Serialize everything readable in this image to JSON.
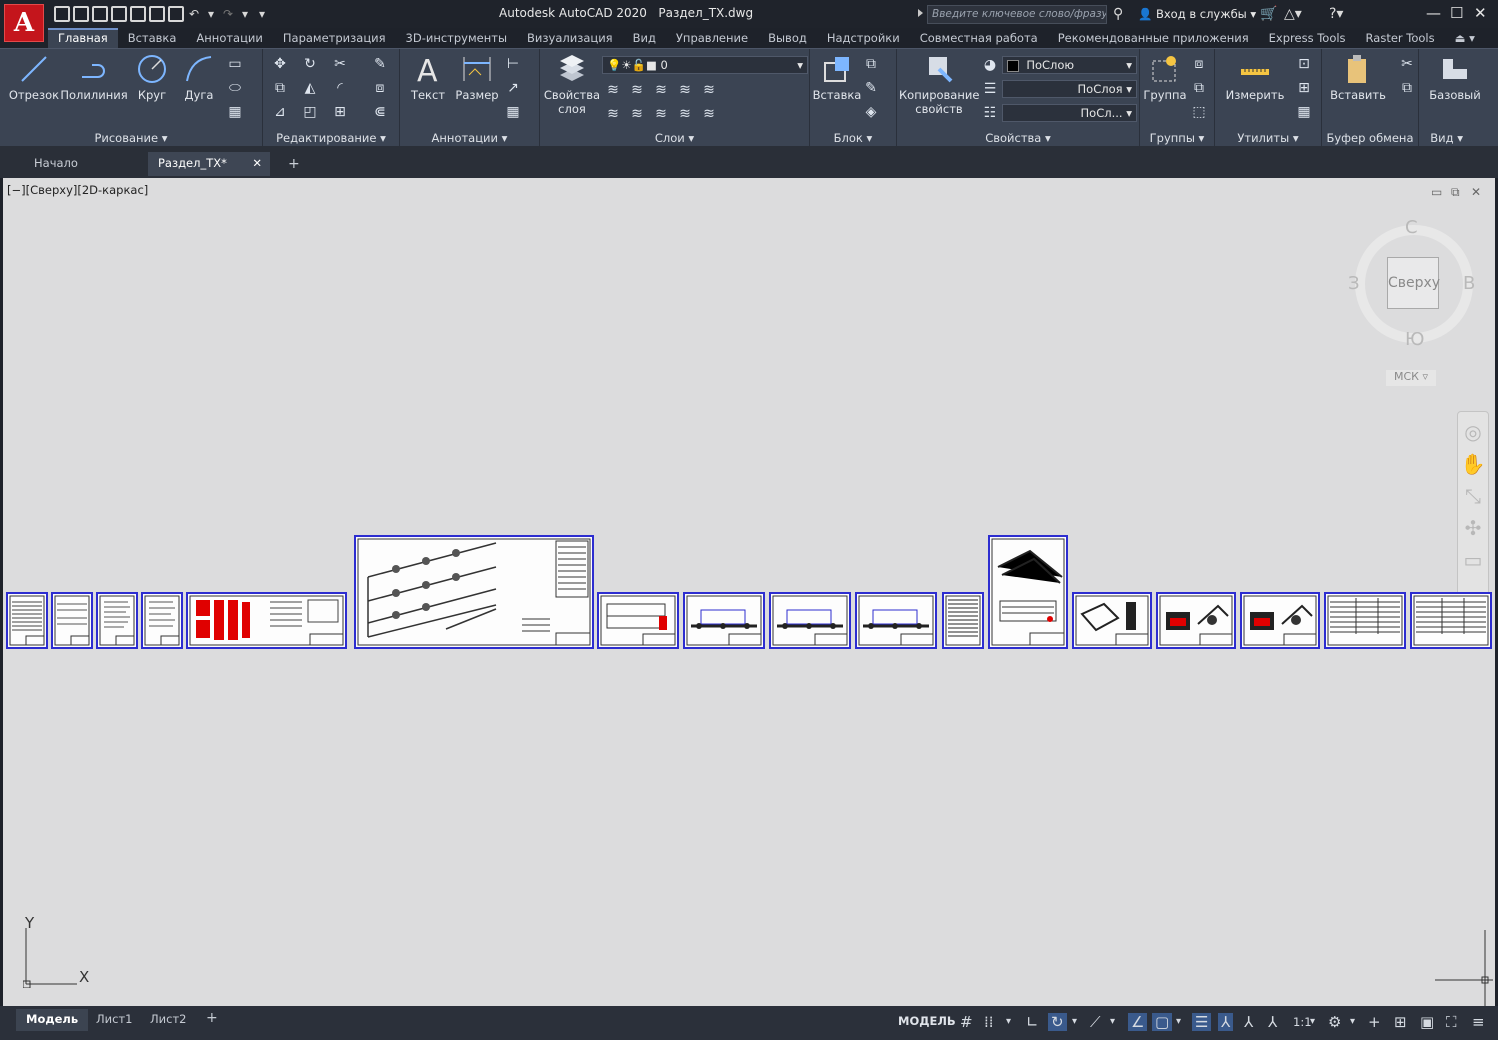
{
  "app": {
    "title": "Autodesk AutoCAD 2020",
    "filename": "Раздел_ТХ.dwg",
    "logo_letter": "A",
    "search_placeholder": "Введите ключевое слово/фразу",
    "signin": "Вход в службы"
  },
  "ribbon_tabs": [
    "Главная",
    "Вставка",
    "Аннотации",
    "Параметризация",
    "3D-инструменты",
    "Визуализация",
    "Вид",
    "Управление",
    "Вывод",
    "Надстройки",
    "Совместная работа",
    "Рекомендованные приложения",
    "Express Tools",
    "Raster Tools"
  ],
  "draw": {
    "line": "Отрезок",
    "polyline": "Полилиния",
    "circle": "Круг",
    "arc": "Дуга",
    "panel": "Рисование"
  },
  "modify": {
    "panel": "Редактирование"
  },
  "annotation": {
    "text": "Текст",
    "dimension": "Размер",
    "panel": "Аннотации"
  },
  "layers": {
    "props_line1": "Свойства",
    "props_line2": "слоя",
    "current_layer": "0",
    "panel": "Слои"
  },
  "block": {
    "insert": "Вставка",
    "panel": "Блок"
  },
  "properties": {
    "match_line1": "Копирование",
    "match_line2": "свойств",
    "color": "ПоСлою",
    "linetype": "ПоСлоя",
    "lineweight": "ПоСл...",
    "panel": "Свойства"
  },
  "groups": {
    "group": "Группа",
    "panel": "Группы"
  },
  "utilities": {
    "measure": "Измерить",
    "panel": "Утилиты"
  },
  "clipboard": {
    "paste": "Вставить",
    "panel": "Буфер обмена"
  },
  "view": {
    "base": "Базовый",
    "panel": "Вид"
  },
  "doc_tabs": {
    "start": "Начало",
    "drawing": "Раздел_ТХ*"
  },
  "viewport": {
    "label": "[−][Сверху][2D-каркас]"
  },
  "viewcube": {
    "face": "Сверху",
    "north": "С",
    "south": "Ю",
    "west": "З",
    "east": "В",
    "ucs": "МСК"
  },
  "ucs_icon": {
    "x": "X",
    "y": "Y"
  },
  "layout_tabs": [
    "Модель",
    "Лист1",
    "Лист2"
  ],
  "status": {
    "model": "МОДЕЛЬ",
    "scale": "1:1"
  },
  "colors": {
    "ribbon": "#3b4453",
    "canvas": "#dcdcdd",
    "sheet_border": "#2d2dd0",
    "accent_red": "#e00000"
  }
}
